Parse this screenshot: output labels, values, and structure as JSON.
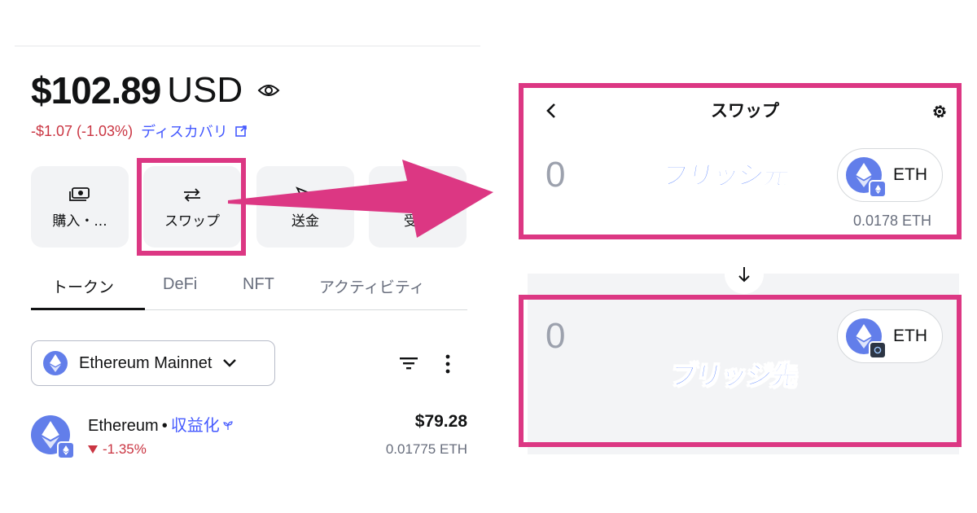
{
  "wallet": {
    "balance": "$102.89",
    "currency": "USD",
    "change": "-$1.07 (-1.03%)",
    "discover_label": "ディスカバリ",
    "actions": [
      {
        "label": "購入・...",
        "icon": "card-cash-icon"
      },
      {
        "label": "スワップ",
        "icon": "swap-arrows-icon"
      },
      {
        "label": "送金",
        "icon": "send-icon"
      },
      {
        "label": "受取",
        "icon": "receive-icon"
      }
    ],
    "tabs": [
      {
        "label": "トークン",
        "active": true
      },
      {
        "label": "DeFi"
      },
      {
        "label": "NFT"
      },
      {
        "label": "アクティビティ"
      }
    ],
    "network": "Ethereum Mainnet",
    "token": {
      "name": "Ethereum",
      "dot": "•",
      "stake_label": "収益化",
      "change": "-1.35%",
      "value": "$79.28",
      "amount": "0.01775 ETH"
    }
  },
  "swap": {
    "title": "スワップ",
    "from": {
      "amount": "0",
      "token": "ETH",
      "balance": "0.0178 ETH"
    },
    "to": {
      "amount": "0",
      "token": "ETH"
    }
  },
  "annotations": {
    "source_label": "ブリッジ元",
    "dest_label": "ブリッジ先"
  },
  "colors": {
    "highlight": "#dc3783",
    "accent_blue": "#4459ff",
    "negative": "#ca3542",
    "eth": "#627eea",
    "annotation": "#4f7cff"
  }
}
